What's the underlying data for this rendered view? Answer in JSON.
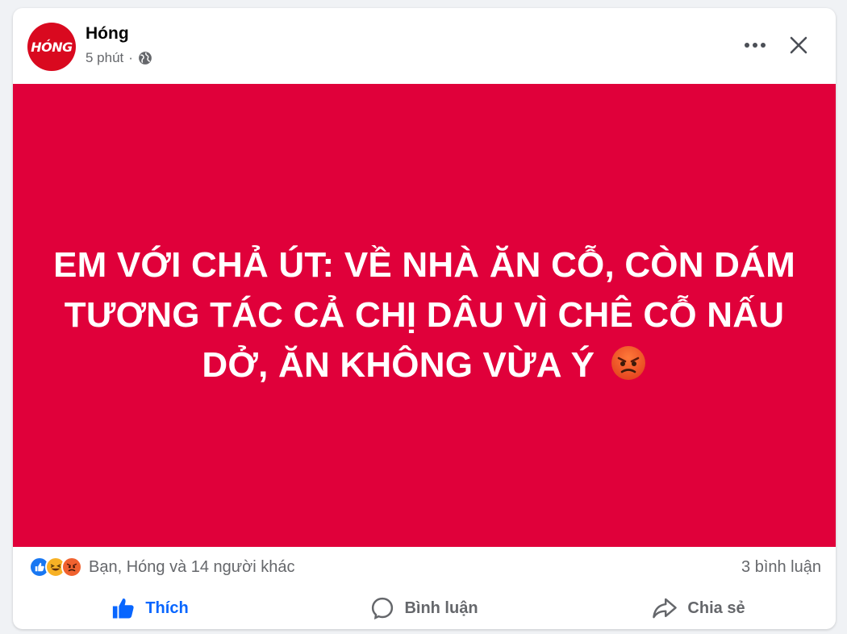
{
  "post": {
    "author": "Hóng",
    "avatar_text": "HÓNG",
    "time": "5 phút",
    "separator": "·",
    "image_bg": "#e0003a",
    "headline": "EM VỚI CHẢ ÚT: VỀ NHÀ ĂN CỖ, CÒN DÁM TƯƠNG TÁC CẢ CHỊ DÂU VÌ CHÊ CỖ NẤU DỞ, ĂN KHÔNG VỪA Ý"
  },
  "header_icons": {
    "more": "more-horizontal-icon",
    "close": "close-icon",
    "privacy": "globe-icon"
  },
  "stats": {
    "reaction_icons": [
      "like-reaction-icon",
      "haha-reaction-icon",
      "angry-reaction-icon"
    ],
    "reaction_text": "Bạn, Hóng và 14 người khác",
    "comment_count": "3 bình luận"
  },
  "actions": {
    "like": "Thích",
    "comment": "Bình luận",
    "share": "Chia sẻ"
  },
  "colors": {
    "accent": "#0866ff",
    "brand_red": "#d9091f",
    "muted_text": "#65676b"
  }
}
